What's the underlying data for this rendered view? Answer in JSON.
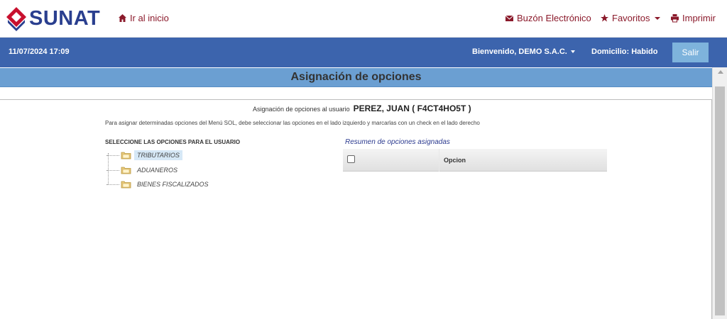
{
  "topnav": {
    "brand": "SUNAT",
    "home_label": "Ir al inicio",
    "buzon_label": "Buzón Electrónico",
    "favoritos_label": "Favoritos",
    "imprimir_label": "Imprimir"
  },
  "statusbar": {
    "datetime": "11/07/2024 17:09",
    "welcome": "Bienvenido, DEMO S.A.C.",
    "domicilio": "Domicilio: Habido",
    "logout_label": "Salir"
  },
  "page": {
    "title": "Asignación de opciones",
    "assign_prefix": "Asignación de opciones al usuario",
    "user": "PEREZ, JUAN ( F4CT4HO5T )",
    "instructions": "Para asignar determinadas opciones del Menú SOL, debe seleccionar las opciones en el lado izquierdo y marcarlas con un check en el lado derecho"
  },
  "tree": {
    "heading": "SELECCIONE LAS OPCIONES PARA EL USUARIO",
    "items": [
      {
        "label": "TRIBUTARIOS",
        "selected": true
      },
      {
        "label": "ADUANEROS",
        "selected": false
      },
      {
        "label": "BIENES FISCALIZADOS",
        "selected": false
      }
    ]
  },
  "summary": {
    "heading": "Resumen de opciones asignadas",
    "column_opcion": "Opcion"
  },
  "colors": {
    "brand_blue": "#2a3f8f",
    "brand_red": "#8b1a2b",
    "status_bar": "#3c64ad",
    "title_bar": "#6b9fd2",
    "logout_button": "#7eb3dc"
  }
}
